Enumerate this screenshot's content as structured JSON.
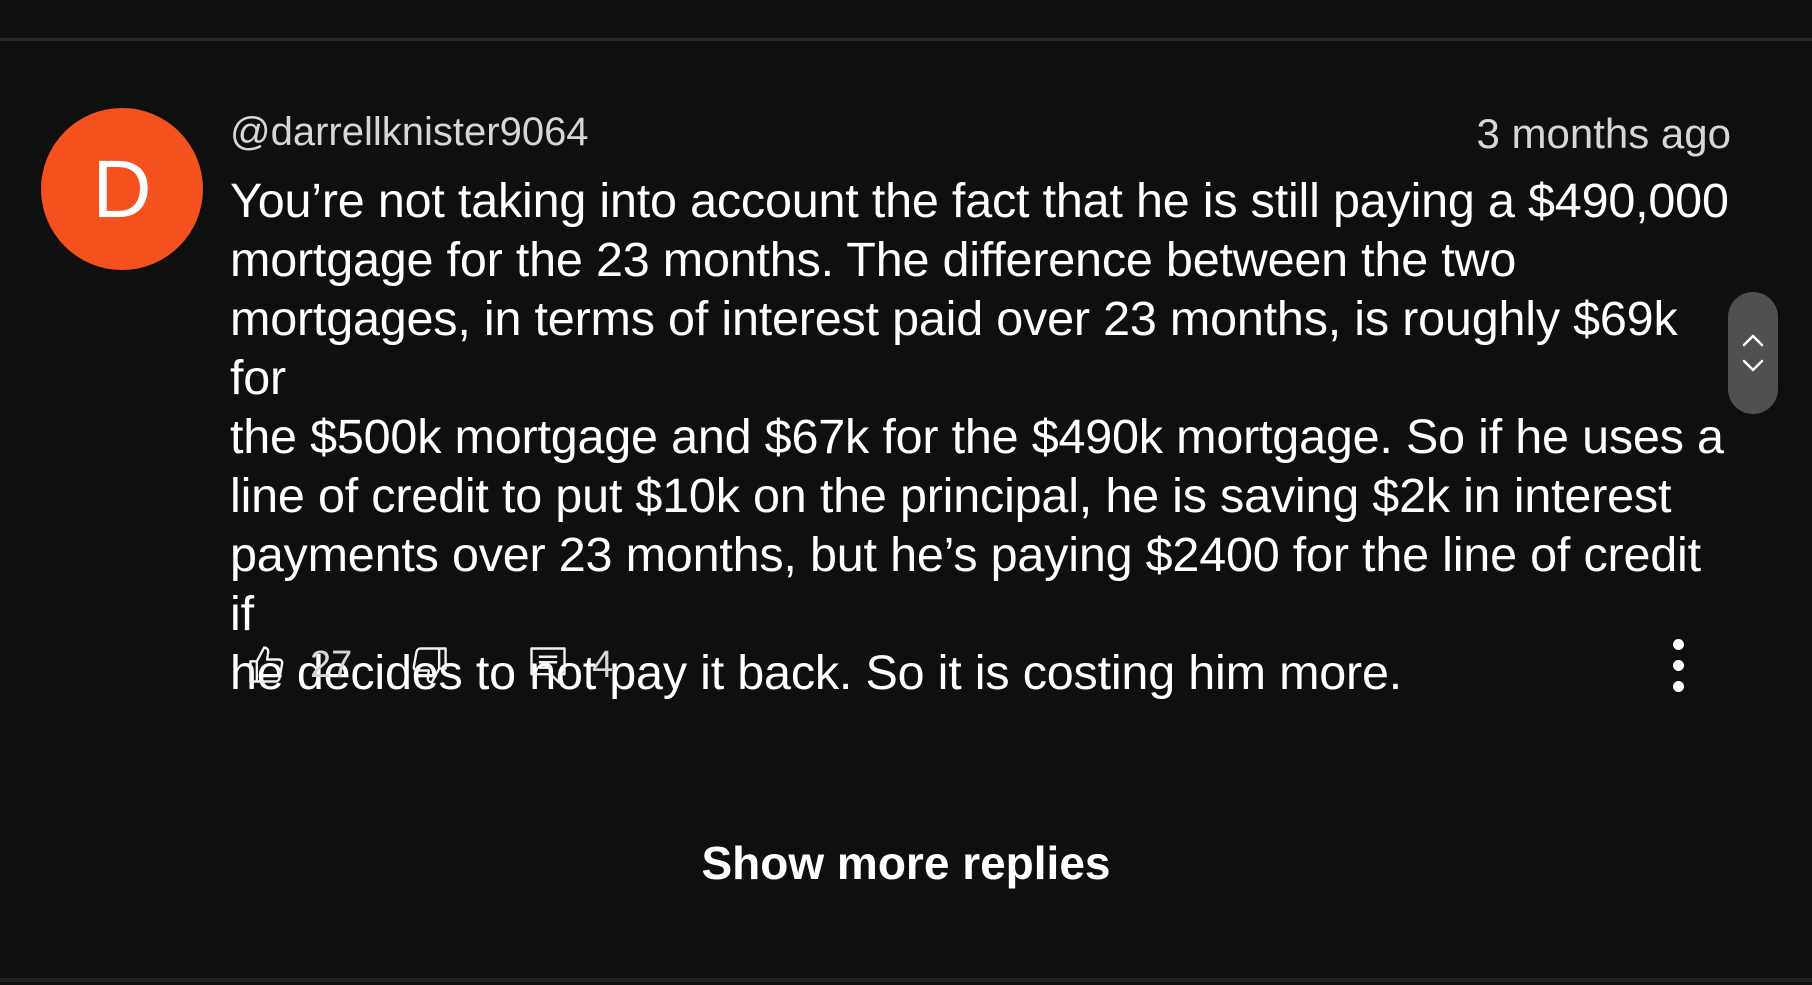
{
  "colors": {
    "background": "#0f0f0f",
    "avatar": "#f4511e",
    "text_primary": "#ffffff",
    "text_secondary": "#d6d6d6"
  },
  "comment": {
    "avatar_letter": "D",
    "author": "@darrellknister9064",
    "timestamp": "3 months ago",
    "lines": [
      "You’re not taking into account the fact that he is still paying a $490,000",
      "mortgage for the 23 months. The difference between the two",
      "mortgages, in terms of interest paid over 23 months, is roughly $69k for",
      "the $500k mortgage and $67k for the $490k mortgage. So if he uses a",
      "line of credit to put $10k on the principal, he is saving $2k in interest",
      "payments over 23 months, but he’s paying $2400 for the line of credit if",
      "he decides to not pay it back. So it is costing him more."
    ],
    "like_count": "27",
    "reply_count": "4"
  },
  "icons": {
    "like": "thumbs-up-icon",
    "dislike": "thumbs-down-icon",
    "reply": "comment-icon",
    "more": "more-vertical-icon",
    "scroll_up": "chevron-up-icon",
    "scroll_down": "chevron-down-icon"
  },
  "footer": {
    "show_more_label": "Show more replies"
  }
}
